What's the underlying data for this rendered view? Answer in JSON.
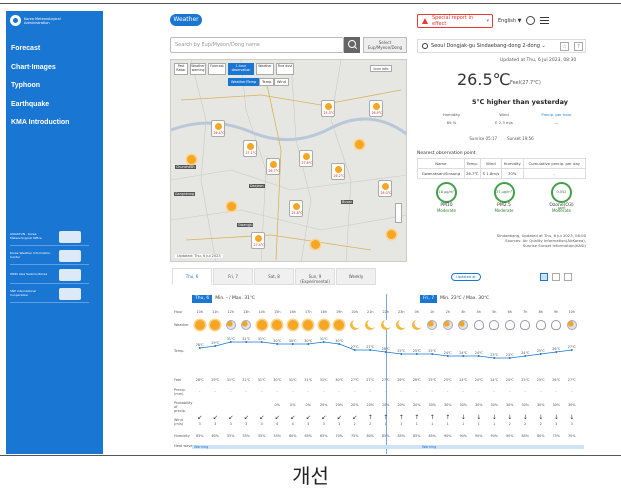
{
  "caption": "개선",
  "sidebar": {
    "brand": "Korea Meteorological Administration",
    "nav": [
      "Forecast",
      "Chart·Images",
      "Typhoon",
      "Earthquake",
      "KMA Introduction"
    ],
    "partners": [
      "ASIASTUN · Korea Meteorological Office",
      "Korea Weather Information Center",
      "WMO Asia Seismic/Korea",
      "SNP International Cooperation"
    ]
  },
  "header": {
    "weather_label": "Weather",
    "alert_label": "Special report in effect",
    "language": "English ▼"
  },
  "search": {
    "placeholder": "Search by Eup/Myeon/Dong name",
    "select_label": "Select Eup/Myeon/Dong"
  },
  "map": {
    "controls": [
      "Past Radar",
      "Weather warning",
      "Forecast",
      "1-hour observation",
      "Weather",
      "Fine dust"
    ],
    "sub_controls": [
      "Weather/Temp",
      "Temp",
      "Wind"
    ],
    "info_label": "Icon info",
    "footer": "Updated: Thu, 6 Jul 2023",
    "tags": [
      "Chuncheon",
      "Gangneung",
      "Daejeon",
      "Gwangju",
      "Busan"
    ],
    "temps": [
      "26.4°C",
      "27.1°C",
      "26.7°C",
      "25.3°C",
      "27.6°C",
      "26.2°C",
      "26.9°C",
      "25.8°C",
      "27.4°C",
      "26.0°C"
    ]
  },
  "current": {
    "location": "Seoul Dongjak-gu Sindaebang-dong 2-dong ⌄",
    "updated": "Updated at Thu, 6 Jul 2023, 08:30",
    "temp": "26.5℃",
    "feels": "Feel(27.7℃)",
    "compare": "5℃ higher than yesterday",
    "humidity_label": "Humidity",
    "humidity": "69 %",
    "wind_label": "Wind",
    "wind": "E 2.3 m/s",
    "precip_label": "Precip. per hour",
    "precip": "—",
    "sunrise": "Sunrise 05:17",
    "sunset": "Sunset 19:56"
  },
  "observation": {
    "title": "Nearest observation point",
    "headers": [
      "Name",
      "Temp.",
      "Wind",
      "Humidity",
      "Cumulative precip. per day"
    ],
    "row": [
      "Gwanaksan/Sinsong",
      "26.7℃",
      "S 1.8m/s",
      "70%",
      "-"
    ]
  },
  "air_quality": {
    "items": [
      {
        "name": "PM10",
        "value": "18 µg/m³",
        "status": "Moderate"
      },
      {
        "name": "PM2.5",
        "value": "37 µg/m³",
        "status": "Moderate"
      },
      {
        "name": "Ozone(O3)",
        "value": "0.052 ppm",
        "status": "Moderate"
      }
    ],
    "source_line1": "Sindaebang, Updated at Thu, 6 Jul 2023, 08:00",
    "source_line2": "Sources: Air Quality Information(AirKorea),",
    "source_line3": "Sunrise Sunset Information(KASI)"
  },
  "forecast": {
    "tabs": [
      "Thu, 6",
      "Fri, 7",
      "Sat, 8",
      "Sun, 9 (Experimental)",
      "Weekly"
    ],
    "updated_label": "Updated at",
    "day1_chip": "Thu, 6",
    "day1_range": "Min. - / Max. 31℃",
    "day2_chip": "Fri, 7",
    "day2_range": "Min. 23℃ / Max. 30℃",
    "row_labels": [
      "Hour",
      "Weather",
      "Temp.",
      "Feel",
      "Precip. (mm)",
      "Probability of precip.",
      "Wind (m/s)",
      "Humidity",
      "Heat wave"
    ],
    "hours": [
      "10h",
      "11h",
      "12h",
      "13h",
      "14h",
      "15h",
      "16h",
      "17h",
      "18h",
      "19h",
      "20h",
      "21h",
      "22h",
      "23h",
      "0h",
      "1h",
      "2h",
      "3h",
      "4h",
      "5h",
      "6h",
      "7h",
      "8h",
      "9h",
      "10h"
    ],
    "weather": [
      "sun",
      "sun",
      "pc",
      "pc",
      "sun",
      "sun",
      "sun",
      "sun",
      "sun",
      "sun",
      "moon",
      "moon",
      "moon",
      "moon",
      "moon",
      "pc",
      "pc",
      "pc",
      "cloud",
      "cloud",
      "cloud",
      "cloud",
      "cloud",
      "cloud",
      "pc"
    ],
    "temps": [
      "28℃",
      "29℃",
      "31℃",
      "31℃",
      "31℃",
      "30℃",
      "30℃",
      "30℃",
      "31℃",
      "30℃",
      "27℃",
      "27℃",
      "26℃",
      "25℃",
      "25℃",
      "25℃",
      "24℃",
      "24℃",
      "24℃",
      "23℃",
      "23℃",
      "24℃",
      "25℃",
      "26℃",
      "27℃"
    ],
    "feels": [
      "28℃",
      "29℃",
      "31℃",
      "31℃",
      "31℃",
      "30℃",
      "31℃",
      "31℃",
      "31℃",
      "30℃",
      "27℃",
      "27℃",
      "27℃",
      "26℃",
      "26℃",
      "25℃",
      "25℃",
      "24℃",
      "24℃",
      "24℃",
      "24℃",
      "25℃",
      "25℃",
      "26℃",
      "27℃"
    ],
    "precip": [
      "-",
      "-",
      "-",
      "-",
      "-",
      "-",
      "-",
      "-",
      "-",
      "-",
      "-",
      "-",
      "-",
      "-",
      "-",
      "-",
      "-",
      "-",
      "-",
      "-",
      "-",
      "-",
      "-",
      "-",
      "-"
    ],
    "probability": [
      "",
      "",
      "",
      "",
      "",
      "0%",
      "0%",
      "0%",
      "20%",
      "20%",
      "20%",
      "20%",
      "20%",
      "20%",
      "20%",
      "30%",
      "30%",
      "30%",
      "30%",
      "30%",
      "30%",
      "30%",
      "30%",
      "30%",
      "30%"
    ],
    "wind_arrows": [
      "↙",
      "↙",
      "↙",
      "↙",
      "↙",
      "↙",
      "↙",
      "↙",
      "↙",
      "↙",
      "↙",
      "↑",
      "↑",
      "↑",
      "↑",
      "↑",
      "↑",
      "↓",
      "↓",
      "↓",
      "↓",
      "↓",
      "↓",
      "↓",
      "↓"
    ],
    "wind_speed": [
      "3",
      "3",
      "3",
      "3",
      "4",
      "4",
      "4",
      "3",
      "3",
      "3",
      "2",
      "2",
      "1",
      "1",
      "1",
      "1",
      "1",
      "1",
      "1",
      "1",
      "2",
      "2",
      "2",
      "3",
      "3"
    ],
    "humidity": [
      "65%",
      "60%",
      "55%",
      "55%",
      "55%",
      "55%",
      "60%",
      "65%",
      "65%",
      "70%",
      "75%",
      "80%",
      "85%",
      "85%",
      "85%",
      "85%",
      "90%",
      "90%",
      "90%",
      "90%",
      "90%",
      "85%",
      "80%",
      "75%",
      "70%"
    ],
    "heatwave_a": "Warning",
    "heatwave_b": "Warning"
  }
}
